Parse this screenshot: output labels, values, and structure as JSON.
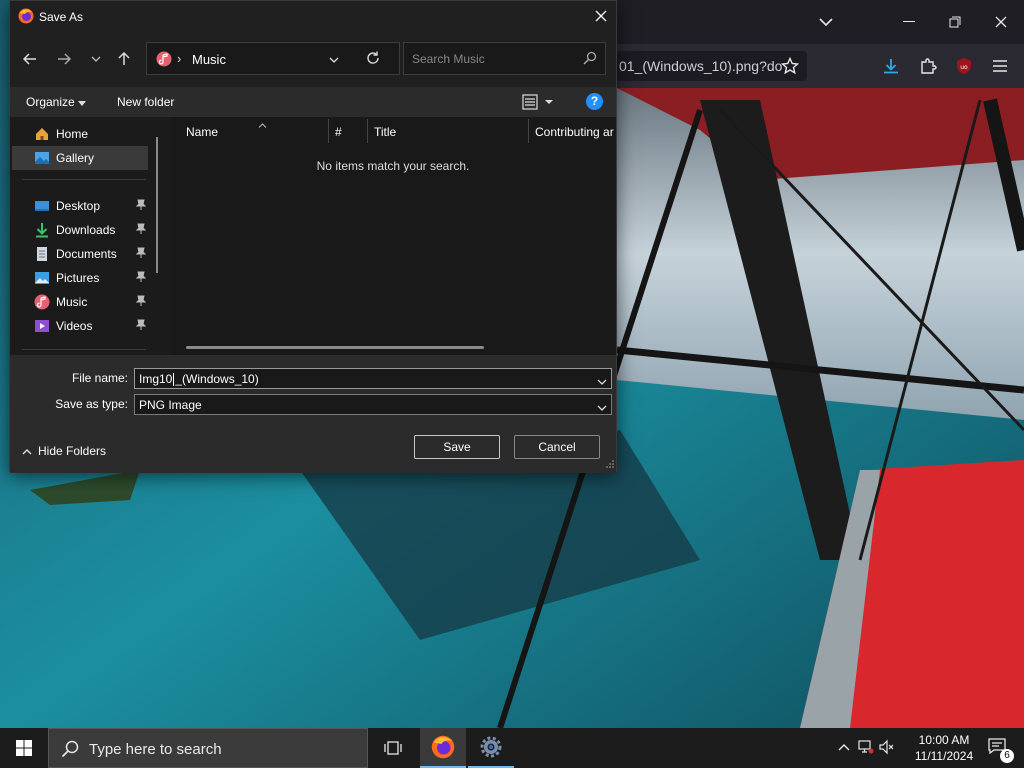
{
  "dialog": {
    "title": "Save As",
    "address_path": "Music",
    "search_placeholder": "Search Music",
    "organize_label": "Organize",
    "new_folder_label": "New folder",
    "help_label": "?"
  },
  "sidebar": {
    "items": [
      {
        "label": "Home",
        "icon": "home-icon"
      },
      {
        "label": "Gallery",
        "icon": "gallery-icon",
        "selected": true
      },
      {
        "label": "Desktop",
        "icon": "desktop-icon",
        "pinned": true
      },
      {
        "label": "Downloads",
        "icon": "downloads-icon",
        "pinned": true
      },
      {
        "label": "Documents",
        "icon": "documents-icon",
        "pinned": true
      },
      {
        "label": "Pictures",
        "icon": "pictures-icon",
        "pinned": true
      },
      {
        "label": "Music",
        "icon": "music-icon",
        "pinned": true
      },
      {
        "label": "Videos",
        "icon": "videos-icon",
        "pinned": true
      }
    ]
  },
  "file_list": {
    "columns": [
      "Name",
      "#",
      "Title",
      "Contributing ar"
    ],
    "empty_message": "No items match your search."
  },
  "form": {
    "file_name_label": "File name:",
    "file_name_value": "Img10",
    "file_name_value_rest": "_(Windows_10)",
    "save_type_label": "Save as type:",
    "save_type_value": "PNG Image",
    "hide_folders_label": "Hide Folders",
    "save_label": "Save",
    "cancel_label": "Cancel"
  },
  "browser": {
    "url_fragment": "01_(Windows_10).png?do"
  },
  "taskbar": {
    "search_placeholder": "Type here to search",
    "time": "10:00 AM",
    "date": "11/11/2024",
    "notification_count": "6"
  },
  "colors": {
    "dialog_bg": "#202020",
    "accent": "#1e90ff",
    "taskbar_bg": "#1c1c1c"
  }
}
